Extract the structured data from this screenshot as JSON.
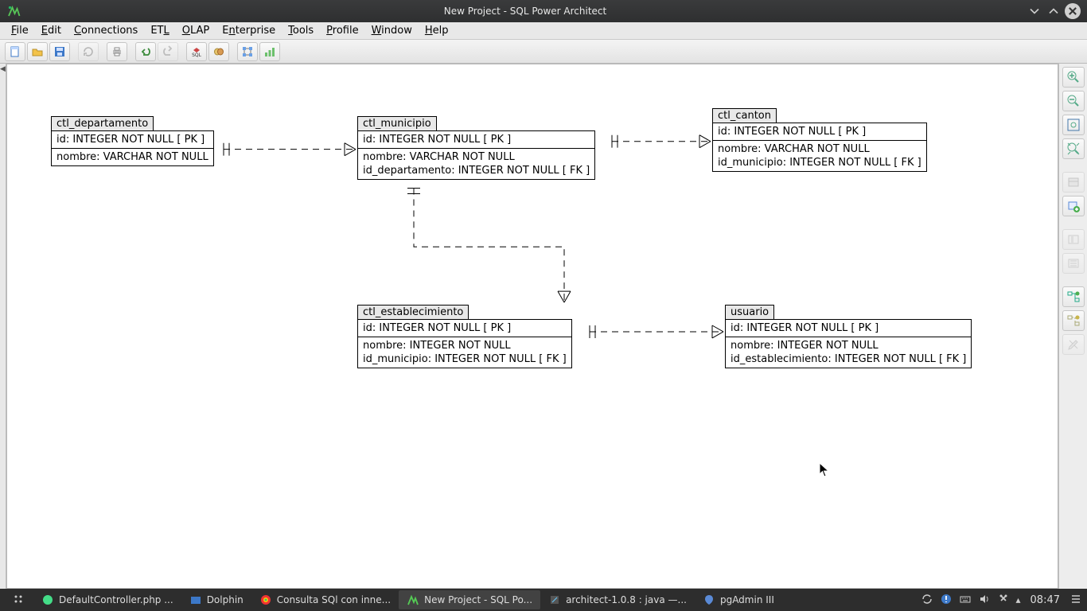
{
  "window": {
    "title": "New Project - SQL Power Architect"
  },
  "menu": {
    "file": "File",
    "edit": "Edit",
    "connections": "Connections",
    "etl": "ETL",
    "olap": "OLAP",
    "enterprise": "Enterprise",
    "tools": "Tools",
    "profile": "Profile",
    "window": "Window",
    "help": "Help"
  },
  "entities": {
    "dep": {
      "name": "ctl_departamento",
      "pk": "id: INTEGER   NOT NULL  [ PK ]",
      "attrs": [
        "nombre: VARCHAR   NOT NULL"
      ]
    },
    "mun": {
      "name": "ctl_municipio",
      "pk": "id: INTEGER   NOT NULL  [ PK ]",
      "attrs": [
        "nombre: VARCHAR   NOT NULL",
        "id_departamento: INTEGER   NOT NULL  [ FK ]"
      ]
    },
    "can": {
      "name": "ctl_canton",
      "pk": "id: INTEGER   NOT NULL  [ PK ]",
      "attrs": [
        "nombre: VARCHAR   NOT NULL",
        "id_municipio: INTEGER   NOT NULL  [ FK ]"
      ]
    },
    "est": {
      "name": "ctl_establecimiento",
      "pk": "id: INTEGER   NOT NULL  [ PK ]",
      "attrs": [
        "nombre: INTEGER   NOT NULL",
        "id_municipio: INTEGER   NOT NULL  [ FK ]"
      ]
    },
    "usu": {
      "name": "usuario",
      "pk": "id: INTEGER   NOT NULL  [ PK ]",
      "attrs": [
        "nombre: INTEGER   NOT NULL",
        "id_establecimiento: INTEGER   NOT NULL  [ FK ]"
      ]
    }
  },
  "taskbar": {
    "items": [
      {
        "label": "DefaultController.php ..."
      },
      {
        "label": "Dolphin"
      },
      {
        "label": "Consulta SQl con inne..."
      },
      {
        "label": "New Project - SQL Po..."
      },
      {
        "label": "architect-1.0.8 : java —..."
      },
      {
        "label": "pgAdmin III"
      }
    ],
    "clock": "08:47"
  }
}
